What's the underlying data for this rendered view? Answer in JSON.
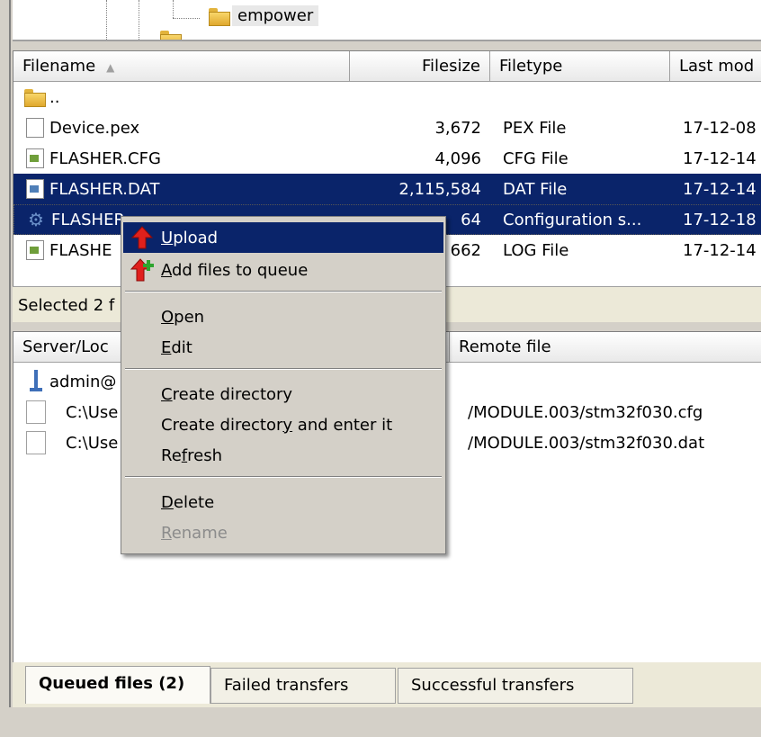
{
  "tree": {
    "folder_label": "empower"
  },
  "filelist": {
    "columns": {
      "filename": "Filename",
      "filesize": "Filesize",
      "filetype": "Filetype",
      "lastmod": "Last mod"
    },
    "rows": [
      {
        "name": "..",
        "size": "",
        "type": "",
        "date": ""
      },
      {
        "name": "Device.pex",
        "size": "3,672",
        "type": "PEX File",
        "date": "17-12-08"
      },
      {
        "name": "FLASHER.CFG",
        "size": "4,096",
        "type": "CFG File",
        "date": "17-12-14"
      },
      {
        "name": "FLASHER.DAT",
        "size": "2,115,584",
        "type": "DAT File",
        "date": "17-12-14"
      },
      {
        "name": "FLASHER.INI",
        "visible_name": "FLASHER",
        "size": "64",
        "type": "Configuration s...",
        "date": "17-12-18"
      },
      {
        "name": "FLASHER.LOG",
        "visible_name": "FLASHE",
        "size": "662",
        "type": "LOG File",
        "date": "17-12-14"
      }
    ]
  },
  "statusbar": {
    "text": "Selected 2 f"
  },
  "queue": {
    "col_local": "Server/Loc",
    "col_remote": "Remote file",
    "server": "admin@",
    "items": [
      {
        "local": "C:\\Use",
        "remote": "/MODULE.003/stm32f030.cfg"
      },
      {
        "local": "C:\\Use",
        "remote": "/MODULE.003/stm32f030.dat"
      }
    ]
  },
  "tabs": [
    {
      "label": "Queued files (2)",
      "active": true
    },
    {
      "label": "Failed transfers",
      "active": false
    },
    {
      "label": "Successful transfers",
      "active": false
    }
  ],
  "context_menu": {
    "upload": {
      "pre": "",
      "u": "U",
      "post": "pload"
    },
    "add_queue": {
      "pre": "",
      "u": "A",
      "post": "dd files to queue"
    },
    "open": {
      "pre": "",
      "u": "O",
      "post": "pen"
    },
    "edit": {
      "pre": "",
      "u": "E",
      "post": "dit"
    },
    "create_dir": {
      "pre": "",
      "u": "C",
      "post": "reate directory"
    },
    "create_dir_enter": {
      "pre": "Create director",
      "u": "y",
      "post": " and enter it"
    },
    "refresh": {
      "pre": "Re",
      "u": "f",
      "post": "resh"
    },
    "delete": {
      "pre": "",
      "u": "D",
      "post": "elete"
    },
    "rename": {
      "pre": "",
      "u": "R",
      "post": "ename"
    }
  },
  "colors": {
    "selection": "#0a246a",
    "menu_bg": "#d4d0c8",
    "upload_arrow": "#e0201c",
    "add_plus": "#2ea52e"
  }
}
